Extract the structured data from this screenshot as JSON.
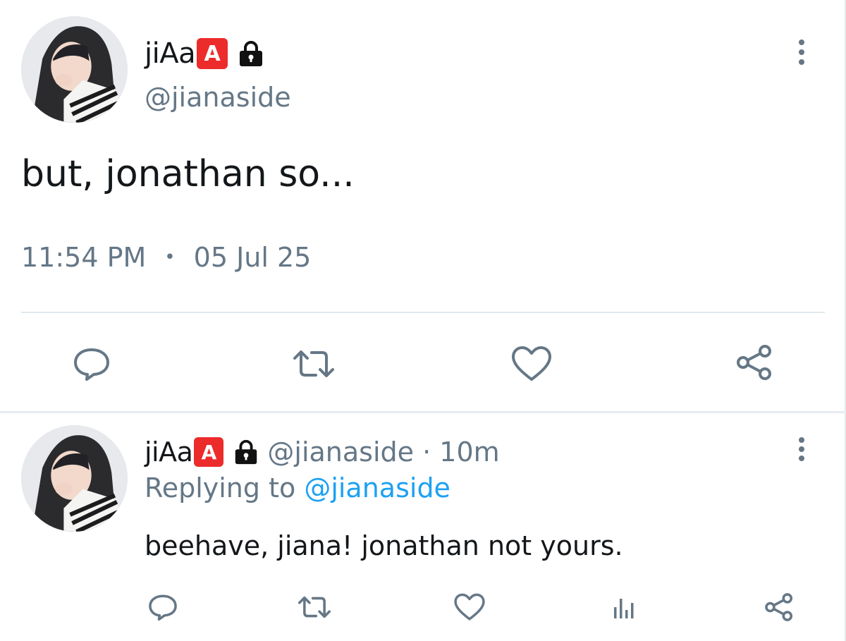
{
  "main_tweet": {
    "display_name": "jiAa",
    "badge": "A",
    "handle": "@jianaside",
    "text": "but, jonathan so...",
    "time": "11:54 PM",
    "separator": "•",
    "date": "05 Jul 25",
    "actions": [
      "reply-icon",
      "retweet-icon",
      "like-icon",
      "share-icon"
    ]
  },
  "reply_tweet": {
    "display_name": "jiAa",
    "badge": "A",
    "handle": "@jianaside",
    "separator": " · ",
    "time_ago": "10m",
    "replying_to_label": "Replying to ",
    "replying_to_handle": "@jianaside",
    "text": "beehave, jiana! jonathan not yours.",
    "actions": [
      "reply-icon",
      "retweet-icon",
      "like-icon",
      "analytics-icon",
      "share-icon"
    ]
  },
  "colors": {
    "text_primary": "#14171a",
    "text_secondary": "#657786",
    "accent_blue": "#1da1f2",
    "badge_red": "#ec2b2b",
    "divider": "#e1e8ed"
  }
}
